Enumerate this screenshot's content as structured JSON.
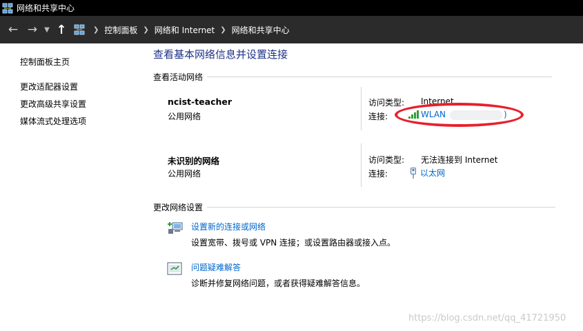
{
  "window": {
    "title": "网络和共享中心",
    "icon": "network-center-icon"
  },
  "addressbar": {
    "crumbs": [
      "控制面板",
      "网络和 Internet",
      "网络和共享中心"
    ]
  },
  "sidebar": {
    "items": [
      {
        "label": "控制面板主页"
      },
      {
        "label": "更改适配器设置"
      },
      {
        "label": "更改高级共享设置"
      },
      {
        "label": "媒体流式处理选项"
      }
    ]
  },
  "main": {
    "title": "查看基本网络信息并设置连接",
    "active_networks_heading": "查看活动网络",
    "networks": [
      {
        "name": "ncist-teacher",
        "type": "公用网络",
        "access_label": "访问类型:",
        "access_value": "Internet",
        "conn_label": "连接:",
        "conn_value": "WLAN",
        "conn_suffix": ")",
        "conn_icon": "wifi-signal-icon"
      },
      {
        "name": "未识别的网络",
        "type": "公用网络",
        "access_label": "访问类型:",
        "access_value": "无法连接到 Internet",
        "conn_label": "连接:",
        "conn_value": "以太网",
        "conn_icon": "ethernet-icon"
      }
    ],
    "change_settings_heading": "更改网络设置",
    "tasks": [
      {
        "link": "设置新的连接或网络",
        "desc": "设置宽带、拨号或 VPN 连接；或设置路由器或接入点。",
        "icon": "new-connection-icon"
      },
      {
        "link": "问题疑难解答",
        "desc": "诊断并修复网络问题，或者获得疑难解答信息。",
        "icon": "troubleshoot-icon"
      }
    ]
  },
  "annotation_color": "#e8202b",
  "watermark": "https://blog.csdn.net/qq_41721950"
}
